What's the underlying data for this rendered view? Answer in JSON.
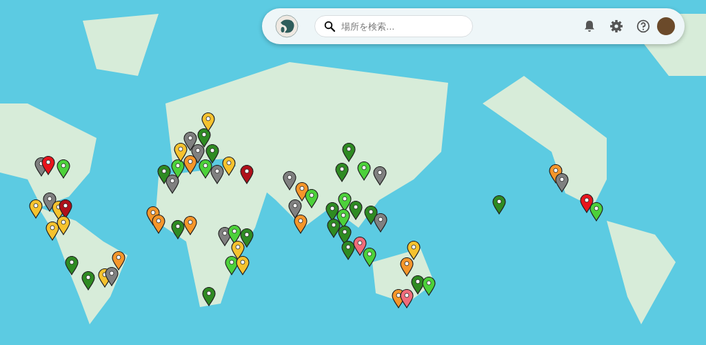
{
  "search": {
    "placeholder": "場所を検索..."
  },
  "pins": [
    {
      "color": "#808080"
    },
    {
      "color": "#e8141c"
    },
    {
      "color": "#4cd13a"
    },
    {
      "color": "#f5c22e"
    },
    {
      "color": "#808080"
    },
    {
      "color": "#f5c22e"
    },
    {
      "color": "#b0101a"
    },
    {
      "color": "#f5c22e"
    },
    {
      "color": "#f5c22e"
    },
    {
      "color": "#f5962a"
    },
    {
      "color": "#2e8b22"
    },
    {
      "color": "#2e8b22"
    },
    {
      "color": "#f5c22e"
    },
    {
      "color": "#808080"
    },
    {
      "color": "#f5962a"
    },
    {
      "color": "#f5962a"
    },
    {
      "color": "#f5962a"
    },
    {
      "color": "#2e8b22"
    },
    {
      "color": "#2e8b22"
    },
    {
      "color": "#808080"
    },
    {
      "color": "#4cd13a"
    },
    {
      "color": "#808080"
    },
    {
      "color": "#808080"
    },
    {
      "color": "#f5c22e"
    },
    {
      "color": "#2e8b22"
    },
    {
      "color": "#2e8b22"
    },
    {
      "color": "#f5962a"
    },
    {
      "color": "#4cd13a"
    },
    {
      "color": "#808080"
    },
    {
      "color": "#f5c22e"
    },
    {
      "color": "#b0101a"
    },
    {
      "color": "#f5c22e"
    },
    {
      "color": "#808080"
    },
    {
      "color": "#4cd13a"
    },
    {
      "color": "#f5c22e"
    },
    {
      "color": "#2e8b22"
    },
    {
      "color": "#4cd13a"
    },
    {
      "color": "#f5c22e"
    },
    {
      "color": "#2e8b22"
    },
    {
      "color": "#808080"
    },
    {
      "color": "#f5962a"
    },
    {
      "color": "#4cd13a"
    },
    {
      "color": "#808080"
    },
    {
      "color": "#f5962a"
    },
    {
      "color": "#2e8b22"
    },
    {
      "color": "#2e8b22"
    },
    {
      "color": "#4cd13a"
    },
    {
      "color": "#808080"
    },
    {
      "color": "#4cd13a"
    },
    {
      "color": "#2e8b22"
    },
    {
      "color": "#2e8b22"
    },
    {
      "color": "#4cd13a"
    },
    {
      "color": "#2e8b22"
    },
    {
      "color": "#2e8b22"
    },
    {
      "color": "#808080"
    },
    {
      "color": "#2e8b22"
    },
    {
      "color": "#2e8b22"
    },
    {
      "color": "#f06b7a"
    },
    {
      "color": "#4cd13a"
    },
    {
      "color": "#f5c22e"
    },
    {
      "color": "#f5962a"
    },
    {
      "color": "#f5962a"
    },
    {
      "color": "#f06b7a"
    },
    {
      "color": "#2e8b22"
    },
    {
      "color": "#4cd13a"
    },
    {
      "color": "#2e8b22"
    },
    {
      "color": "#f5962a"
    },
    {
      "color": "#808080"
    },
    {
      "color": "#e8141c"
    },
    {
      "color": "#4cd13a"
    }
  ]
}
